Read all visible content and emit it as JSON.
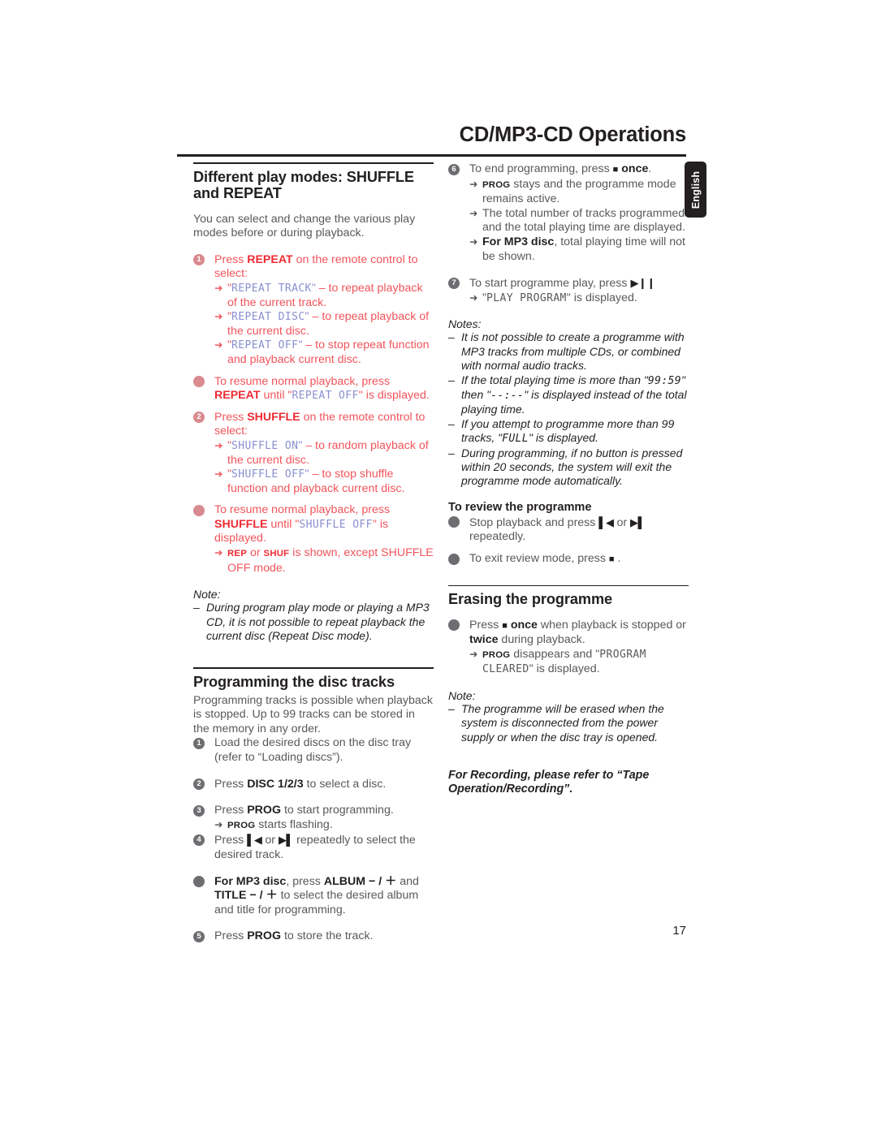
{
  "header": {
    "title": "CD/MP3-CD Operations",
    "language_tab": "English",
    "page_number": "17"
  },
  "left_column": {
    "section1": {
      "heading": "Different play modes: SHUFFLE and REPEAT",
      "intro": "You can select and change the various play modes before or during playback.",
      "step1": {
        "marker": "1",
        "text_before": "Press ",
        "bold": "REPEAT",
        "text_after": " on the remote control to select:",
        "arrows": [
          {
            "arrow": "➜",
            "quote_open": "\"",
            "lcd": "REPEAT  TRACK",
            "quote_close": "\"",
            "rest": " – to repeat playback of the current track."
          },
          {
            "arrow": "➜",
            "quote_open": "\"",
            "lcd": "REPEAT  DISC",
            "quote_close": "\"",
            "rest": " – to repeat playback of the current disc."
          },
          {
            "arrow": "➜",
            "quote_open": "\"",
            "lcd": "REPEAT  OFF",
            "quote_close": "\"",
            "rest": " – to stop repeat function and playback current disc."
          }
        ]
      },
      "bullet1": {
        "text_before": "To resume normal playback, press ",
        "bold": "REPEAT",
        "text_mid": " until \"",
        "lcd": "REPEAT  OFF",
        "text_after": "\" is displayed."
      },
      "step2": {
        "marker": "2",
        "text_before": "Press ",
        "bold": "SHUFFLE",
        "text_after": " on the remote control to select:",
        "arrows": [
          {
            "arrow": "➜",
            "quote_open": "\"",
            "lcd": "SHUFFLE  ON",
            "quote_close": "\"",
            "rest": " – to random playback of the current disc."
          },
          {
            "arrow": "➜",
            "quote_open": "\"",
            "lcd": "SHUFFLE  OFF",
            "quote_close": "\"",
            "rest": " – to stop shuffle function and playback current disc."
          }
        ]
      },
      "bullet2": {
        "text_before": "To resume normal playback, press ",
        "bold": "SHUFFLE",
        "text_mid": " until \"",
        "lcd": "SHUFFLE  OFF",
        "text_after": "\" is displayed."
      },
      "bullet2_arrow": {
        "arrow": "➜",
        "caps1": "REP",
        "mid": " or ",
        "caps2": "SHUF",
        "rest": " is shown, except SHUFFLE OFF mode."
      },
      "note": {
        "label": "Note:",
        "dash": "–",
        "text": "During program play mode or playing a MP3 CD, it is not possible to repeat playback the current disc (Repeat Disc mode)."
      }
    },
    "section2": {
      "heading": "Programming the disc tracks",
      "intro": "Programming tracks is possible when playback is stopped. Up to 99 tracks can be stored in the memory in any order.",
      "steps": [
        {
          "marker": "1",
          "text": "Load the desired discs on the disc tray (refer to “Loading discs”)."
        },
        {
          "marker": "2",
          "text_before": "Press ",
          "bold": "DISC 1/2/3",
          "text_after": " to select a disc."
        },
        {
          "marker": "3",
          "text_before": "Press ",
          "bold": "PROG",
          "text_after": " to start programming.",
          "arrow": "➜",
          "arrow_caps": "PROG",
          "arrow_rest": " starts flashing."
        },
        {
          "marker": "4",
          "text_before": "Press ",
          "glyph1": "▌◀",
          "text_mid": " or ",
          "glyph2": "▶▌",
          "text_after": " repeatedly to select the desired track."
        }
      ],
      "bullet_mp3": {
        "bold1": "For MP3 disc",
        "text1": ", press ",
        "bold2": "ALBUM",
        "sign1": " − / ＋",
        "text2": " and ",
        "bold3": "TITLE",
        "sign2": " − / ＋",
        "text3": " to select the desired album and title for programming."
      },
      "step5": {
        "marker": "5",
        "text_before": "Press ",
        "bold": "PROG",
        "text_after": " to store the track."
      }
    }
  },
  "right_column": {
    "step6": {
      "marker": "6",
      "text_before": "To end programming, press ",
      "glyph": "■",
      "bold": " once",
      "text_after": ".",
      "arrows": [
        {
          "arrow": "➜",
          "caps": "PROG",
          "rest": " stays and the programme mode remains active."
        },
        {
          "arrow": "➜",
          "rest": "The total number of tracks programmed and the total playing time are displayed."
        },
        {
          "arrow": "➜",
          "bold": "For MP3 disc",
          "rest": ", total playing time will not be shown."
        }
      ]
    },
    "step7": {
      "marker": "7",
      "text_before": "To start programme play, press ",
      "glyph": "▶❙❙",
      "arrow": "➜",
      "quote_open": "\"",
      "lcd": "PLAY  PROGRAM",
      "quote_close": "\"",
      "arrow_rest": " is displayed."
    },
    "notes": {
      "label": "Notes:",
      "items": [
        {
          "dash": "–",
          "text": "It is not possible to create a programme with MP3 tracks from multiple CDs, or combined with normal audio tracks."
        },
        {
          "dash": "–",
          "pre": "If the total playing time is more than \"",
          "lcd": "99:59",
          "mid": "\" then \"",
          "lcd2": "--:--",
          "post": "\" is displayed instead of the total playing time."
        },
        {
          "dash": "–",
          "pre": "If you attempt to programme more than 99 tracks, \"",
          "lcd": "FULL",
          "post": "\" is displayed."
        },
        {
          "dash": "–",
          "text": "During programming, if no button is pressed within 20 seconds, the system will exit the programme mode automatically."
        }
      ]
    },
    "review": {
      "heading": "To review the programme",
      "bullet1": {
        "text_before": "Stop playback and press ",
        "glyph1": "▌◀",
        "text_mid": " or ",
        "glyph2": "▶▌",
        "text_after": " repeatedly."
      },
      "bullet2": {
        "text_before": "To exit review mode, press ",
        "glyph": "■",
        "text_after": " ."
      }
    },
    "erasing": {
      "heading": "Erasing the programme",
      "bullet": {
        "text_before": "Press ",
        "glyph": "■",
        "bold1": " once",
        "text_mid": " when playback is stopped or ",
        "bold2": "twice",
        "text_after": " during playback."
      },
      "arrow": {
        "arrow": "➜",
        "caps": "PROG",
        "mid": " disappears and \"",
        "lcd": "PROGRAM  CLEARED",
        "post": "\" is displayed."
      },
      "note": {
        "label": "Note:",
        "dash": "–",
        "text": "The programme will be erased when the system is disconnected from the power supply or when the disc tray is opened."
      },
      "footer": "For Recording, please refer to “Tape Operation/Recording”."
    }
  }
}
